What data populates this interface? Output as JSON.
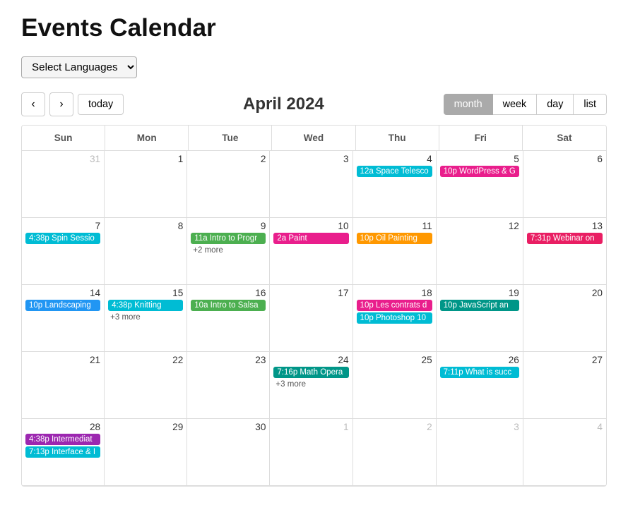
{
  "page": {
    "title": "Events Calendar"
  },
  "controls": {
    "language_select_label": "Select Languages",
    "today_button": "today",
    "month_title": "April 2024"
  },
  "view_buttons": [
    {
      "label": "month",
      "active": true
    },
    {
      "label": "week",
      "active": false
    },
    {
      "label": "day",
      "active": false
    },
    {
      "label": "list",
      "active": false
    }
  ],
  "weekdays": [
    "Sun",
    "Mon",
    "Tue",
    "Wed",
    "Thu",
    "Fri",
    "Sat"
  ],
  "weeks": [
    {
      "days": [
        {
          "num": "31",
          "grey": true,
          "events": []
        },
        {
          "num": "1",
          "grey": false,
          "events": []
        },
        {
          "num": "2",
          "grey": false,
          "events": []
        },
        {
          "num": "3",
          "grey": false,
          "events": []
        },
        {
          "num": "4",
          "grey": false,
          "events": [
            {
              "time": "12a",
              "title": "Space Telesco",
              "color": "event-cyan"
            }
          ]
        },
        {
          "num": "5",
          "grey": false,
          "events": [
            {
              "time": "10p",
              "title": "WordPress & G",
              "color": "event-pink"
            }
          ]
        },
        {
          "num": "6",
          "grey": false,
          "events": []
        }
      ]
    },
    {
      "days": [
        {
          "num": "7",
          "grey": false,
          "events": [
            {
              "time": "4:38p",
              "title": "Spin Sessio",
              "color": "event-cyan"
            }
          ]
        },
        {
          "num": "8",
          "grey": false,
          "events": []
        },
        {
          "num": "9",
          "grey": false,
          "events": [
            {
              "time": "11a",
              "title": "Intro to Progr",
              "color": "event-green"
            },
            {
              "more": "+2 more"
            }
          ]
        },
        {
          "num": "10",
          "grey": false,
          "events": [
            {
              "time": "2a",
              "title": "Paint",
              "color": "event-pink"
            }
          ]
        },
        {
          "num": "11",
          "grey": false,
          "events": [
            {
              "time": "10p",
              "title": "Oil Painting",
              "color": "event-orange"
            }
          ]
        },
        {
          "num": "12",
          "grey": false,
          "events": []
        },
        {
          "num": "13",
          "grey": false,
          "events": [
            {
              "time": "7:31p",
              "title": "Webinar on",
              "color": "event-magenta"
            }
          ]
        }
      ]
    },
    {
      "days": [
        {
          "num": "14",
          "grey": false,
          "events": [
            {
              "time": "10p",
              "title": "Landscaping",
              "color": "event-blue"
            }
          ]
        },
        {
          "num": "15",
          "grey": false,
          "events": [
            {
              "time": "4:38p",
              "title": "Knitting",
              "color": "event-cyan"
            },
            {
              "more": "+3 more"
            }
          ]
        },
        {
          "num": "16",
          "grey": false,
          "events": [
            {
              "time": "10a",
              "title": "Intro to Salsa",
              "color": "event-green"
            }
          ]
        },
        {
          "num": "17",
          "grey": false,
          "events": []
        },
        {
          "num": "18",
          "grey": false,
          "events": [
            {
              "time": "10p",
              "title": "Les contrats d",
              "color": "event-pink"
            },
            {
              "time": "10p",
              "title": "Photoshop 10",
              "color": "event-cyan"
            }
          ]
        },
        {
          "num": "19",
          "grey": false,
          "events": [
            {
              "time": "10p",
              "title": "JavaScript an",
              "color": "event-teal"
            }
          ]
        },
        {
          "num": "20",
          "grey": false,
          "events": []
        }
      ]
    },
    {
      "days": [
        {
          "num": "21",
          "grey": false,
          "events": []
        },
        {
          "num": "22",
          "grey": false,
          "events": []
        },
        {
          "num": "23",
          "grey": false,
          "events": []
        },
        {
          "num": "24",
          "grey": false,
          "events": [
            {
              "time": "7:16p",
              "title": "Math Opera",
              "color": "event-teal"
            },
            {
              "more": "+3 more"
            }
          ]
        },
        {
          "num": "25",
          "grey": false,
          "events": []
        },
        {
          "num": "26",
          "grey": false,
          "events": [
            {
              "time": "7:11p",
              "title": "What is succ",
              "color": "event-cyan"
            }
          ]
        },
        {
          "num": "27",
          "grey": false,
          "events": []
        }
      ]
    },
    {
      "days": [
        {
          "num": "28",
          "grey": false,
          "events": [
            {
              "time": "4:38p",
              "title": "Intermediat",
              "color": "event-purple"
            },
            {
              "time": "7:13p",
              "title": "Interface & I",
              "color": "event-cyan"
            }
          ]
        },
        {
          "num": "29",
          "grey": false,
          "events": []
        },
        {
          "num": "30",
          "grey": false,
          "events": []
        },
        {
          "num": "1",
          "grey": true,
          "events": []
        },
        {
          "num": "2",
          "grey": true,
          "events": []
        },
        {
          "num": "3",
          "grey": true,
          "events": []
        },
        {
          "num": "4",
          "grey": true,
          "events": []
        }
      ]
    }
  ]
}
